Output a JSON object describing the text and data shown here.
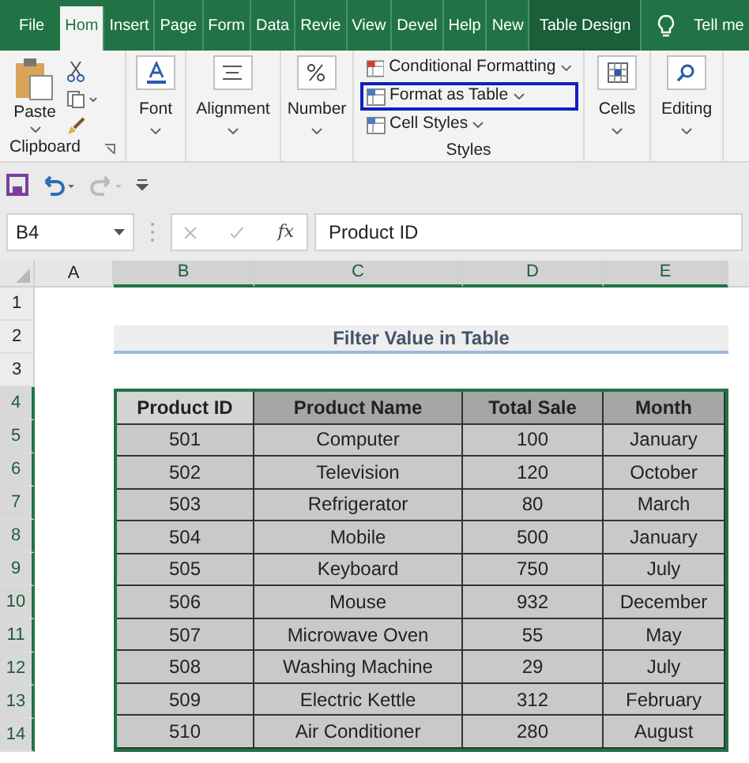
{
  "ribbon_tabs": [
    {
      "label": "File",
      "selected": false
    },
    {
      "label": "Hom",
      "selected": true
    },
    {
      "label": "Insert",
      "selected": false
    },
    {
      "label": "Page",
      "selected": false
    },
    {
      "label": "Form",
      "selected": false
    },
    {
      "label": "Data",
      "selected": false
    },
    {
      "label": "Revie",
      "selected": false
    },
    {
      "label": "View",
      "selected": false
    },
    {
      "label": "Devel",
      "selected": false
    },
    {
      "label": "Help",
      "selected": false
    },
    {
      "label": "New",
      "selected": false
    },
    {
      "label": "Table Design",
      "selected": false
    }
  ],
  "tell_me": "Tell me",
  "clipboard": {
    "paste": "Paste",
    "label": "Clipboard"
  },
  "ribbon_groups": [
    {
      "kind": "font",
      "label": "Font"
    },
    {
      "kind": "alignment",
      "label": "Alignment"
    },
    {
      "kind": "number",
      "label": "Number"
    },
    {
      "kind": "styles",
      "label": "Styles",
      "items": [
        {
          "label": "Conditional Formatting",
          "highlighted": false
        },
        {
          "label": "Format as Table",
          "highlighted": true
        },
        {
          "label": "Cell Styles",
          "highlighted": false
        }
      ]
    },
    {
      "kind": "cells",
      "label": "Cells"
    },
    {
      "kind": "editing",
      "label": "Editing"
    }
  ],
  "name_box": "B4",
  "function_button": "fx",
  "formula": "Product ID",
  "columns": [
    {
      "label": "A",
      "selected": false
    },
    {
      "label": "B",
      "selected": true
    },
    {
      "label": "C",
      "selected": true
    },
    {
      "label": "D",
      "selected": true
    },
    {
      "label": "E",
      "selected": true
    }
  ],
  "rows": [
    {
      "label": "1",
      "selected": false
    },
    {
      "label": "2",
      "selected": false
    },
    {
      "label": "3",
      "selected": false
    },
    {
      "label": "4",
      "selected": true
    },
    {
      "label": "5",
      "selected": true
    },
    {
      "label": "6",
      "selected": true
    },
    {
      "label": "7",
      "selected": true
    },
    {
      "label": "8",
      "selected": true
    },
    {
      "label": "9",
      "selected": true
    },
    {
      "label": "10",
      "selected": true
    },
    {
      "label": "11",
      "selected": true
    },
    {
      "label": "12",
      "selected": true
    },
    {
      "label": "13",
      "selected": true
    },
    {
      "label": "14",
      "selected": true
    }
  ],
  "sheet_title": "Filter Value in Table",
  "table": {
    "columns": [
      {
        "label": "Product ID",
        "selected": true
      },
      {
        "label": "Product Name",
        "selected": false
      },
      {
        "label": "Total Sale",
        "selected": false
      },
      {
        "label": "Month",
        "selected": false
      }
    ],
    "rows": [
      [
        "501",
        "Computer",
        "100",
        "January"
      ],
      [
        "502",
        "Television",
        "120",
        "October"
      ],
      [
        "503",
        "Refrigerator",
        "80",
        "March"
      ],
      [
        "504",
        "Mobile",
        "500",
        "January"
      ],
      [
        "505",
        "Keyboard",
        "750",
        "July"
      ],
      [
        "506",
        "Mouse",
        "932",
        "December"
      ],
      [
        "507",
        "Microwave Oven",
        "55",
        "May"
      ],
      [
        "508",
        "Washing Machine",
        "29",
        "July"
      ],
      [
        "509",
        "Electric Kettle",
        "312",
        "February"
      ],
      [
        "510",
        "Air Conditioner",
        "280",
        "August"
      ]
    ]
  }
}
